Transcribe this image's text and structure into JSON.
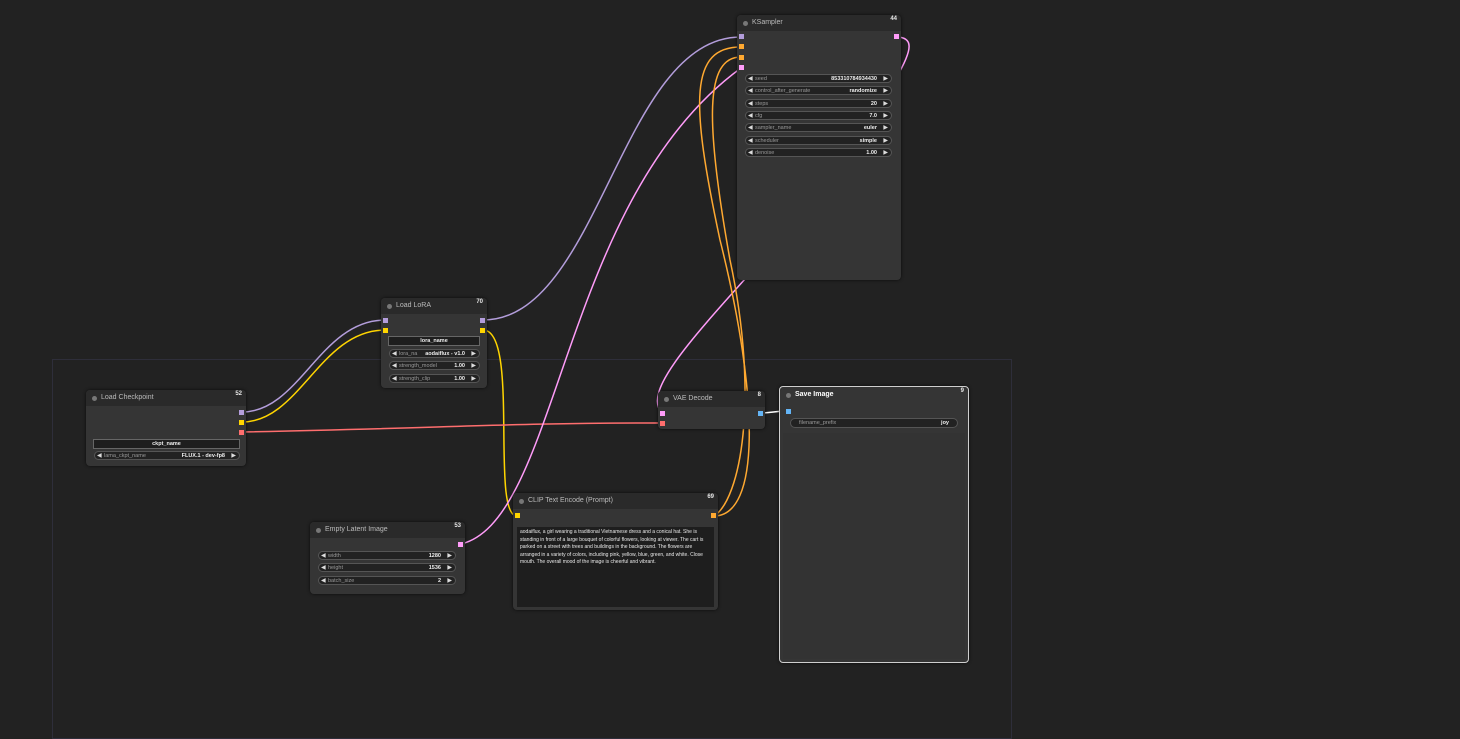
{
  "colors": {
    "model": "#b39ddb",
    "clip": "#ffd500",
    "vae": "#ff6e6e",
    "latent": "#ff9cf9",
    "conditioning": "#ffa931",
    "image": "#64b5f6"
  },
  "nodes": {
    "ksampler": {
      "title": "KSampler",
      "id": "44",
      "widgets": [
        {
          "label": "seed",
          "value": "853310784934430"
        },
        {
          "label": "control_after_generate",
          "value": "randomize"
        },
        {
          "label": "steps",
          "value": "20"
        },
        {
          "label": "cfg",
          "value": "7.0"
        },
        {
          "label": "sampler_name",
          "value": "euler"
        },
        {
          "label": "scheduler",
          "value": "simple"
        },
        {
          "label": "denoise",
          "value": "1.00"
        }
      ]
    },
    "load_lora": {
      "title": "Load LoRA",
      "id": "70",
      "header_field": "lora_name",
      "widgets": [
        {
          "label": "lora_na",
          "value": "aodaiflux - v1.0"
        },
        {
          "label": "strength_model",
          "value": "1.00"
        },
        {
          "label": "strength_clip",
          "value": "1.00"
        }
      ]
    },
    "load_checkpoint": {
      "title": "Load Checkpoint",
      "id": "52",
      "header_field": "ckpt_name",
      "widgets": [
        {
          "label": "lama_ckpt_name",
          "value": "FLUX.1 - dev-fp8"
        }
      ]
    },
    "vae_decode": {
      "title": "VAE Decode",
      "id": "8"
    },
    "save_image": {
      "title": "Save Image",
      "id": "9",
      "widgets": [
        {
          "label": "filename_prefix",
          "value": "joy"
        }
      ]
    },
    "clip_text_encode": {
      "title": "CLIP Text Encode (Prompt)",
      "id": "69",
      "text": "aodaiflux, a girl wearing a traditional Vietnamese dress and a conical hat. She is standing in front of a large bouquet of colorful flowers, looking at viewer. The cart is parked on a street with trees and buildings in the background. The flowers are arranged in a variety of colors, including pink, yellow, blue, green, and white. Close mouth. The overall mood of the image is cheerful and vibrant."
    },
    "empty_latent": {
      "title": "Empty Latent Image",
      "id": "53",
      "widgets": [
        {
          "label": "width",
          "value": "1280"
        },
        {
          "label": "height",
          "value": "1536"
        },
        {
          "label": "batch_size",
          "value": "2"
        }
      ]
    }
  }
}
